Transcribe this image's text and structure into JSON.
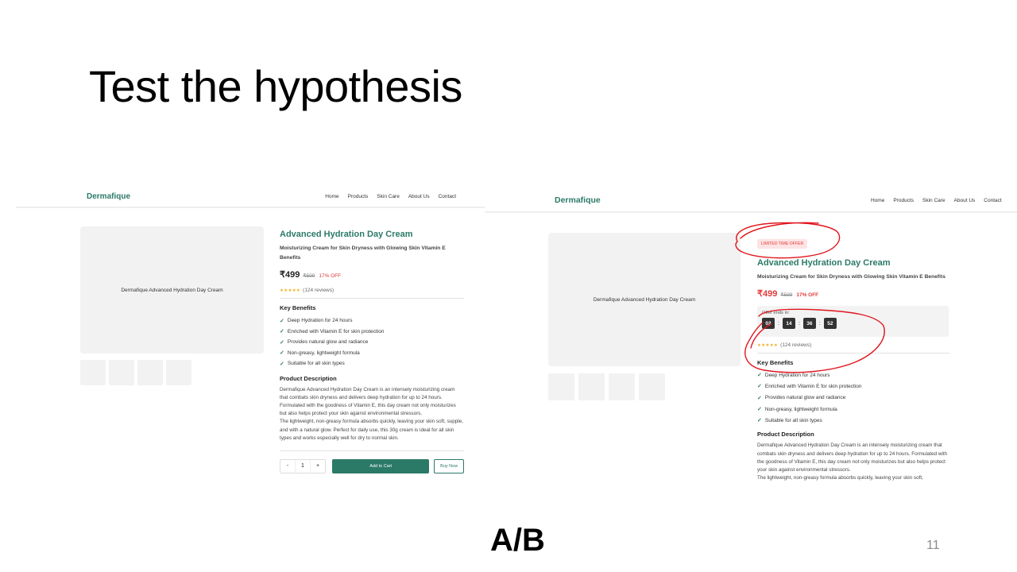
{
  "slide": {
    "title": "Test the hypothesis",
    "footer": "A/B",
    "page_number": "11"
  },
  "variant_a": {
    "brand": "Dermafique",
    "nav": [
      "Home",
      "Products",
      "Skin Care",
      "About Us",
      "Contact"
    ],
    "image_caption": "Dermafique Advanced Hydration Day Cream",
    "product_title": "Advanced Hydration Day Cream",
    "subtitle": "Moisturizing Cream for Skin Dryness with Glowing Skin Vitamin E Benefits",
    "price": "₹499",
    "old_price": "₹599",
    "discount": "17% OFF",
    "stars": "★★★★★",
    "reviews": "(124 reviews)",
    "benefits_heading": "Key Benefits",
    "benefits": [
      "Deep Hydration for 24 hours",
      "Enriched with Vitamin E for skin protection",
      "Provides natural glow and radiance",
      "Non-greasy, lightweight formula",
      "Suitable for all skin types"
    ],
    "description_heading": "Product Description",
    "description_p1": "Dermafique Advanced Hydration Day Cream is an intensely moisturizing cream that combats skin dryness and delivers deep hydration for up to 24 hours. Formulated with the goodness of Vitamin E, this day cream not only moisturizes but also helps protect your skin against environmental stressors.",
    "description_p2": "The lightweight, non-greasy formula absorbs quickly, leaving your skin soft, supple, and with a natural glow. Perfect for daily use, this 30g cream is ideal for all skin types and works especially well for dry to normal skin.",
    "qty_minus": "-",
    "qty_value": "1",
    "qty_plus": "+",
    "add_to_cart": "Add to Cart",
    "buy_now": "Buy Now"
  },
  "variant_b": {
    "brand": "Dermafique",
    "nav": [
      "Home",
      "Products",
      "Skin Care",
      "About Us",
      "Contact"
    ],
    "badge": "LIMITED TIME OFFER",
    "image_caption": "Dermafique Advanced Hydration Day Cream",
    "product_title": "Advanced Hydration Day Cream",
    "subtitle": "Moisturizing Cream for Skin Dryness with Glowing Skin Vitamin E Benefits",
    "price": "₹499",
    "old_price": "₹599",
    "discount": "17% OFF",
    "timer_label": "Offer ends in:",
    "timer": [
      "02",
      "14",
      "36",
      "52"
    ],
    "stars": "★★★★★",
    "reviews": "(124 reviews)",
    "benefits_heading": "Key Benefits",
    "benefits": [
      "Deep Hydration for 24 hours",
      "Enriched with Vitamin E for skin protection",
      "Provides natural glow and radiance",
      "Non-greasy, lightweight formula",
      "Suitable for all skin types"
    ],
    "description_heading": "Product Description",
    "description_p1": "Dermafique Advanced Hydration Day Cream is an intensely moisturizing cream that combats skin dryness and delivers deep hydration for up to 24 hours. Formulated with the goodness of Vitamin E, this day cream not only moisturizes but also helps protect your skin against environmental stressors.",
    "description_p2": "The lightweight, non-greasy formula absorbs quickly, leaving your skin soft,"
  },
  "colors": {
    "brand_green": "#2b7a68",
    "price_red": "#e23b3b",
    "annotation_red": "#e0161d",
    "star_yellow": "#f2b01e"
  }
}
